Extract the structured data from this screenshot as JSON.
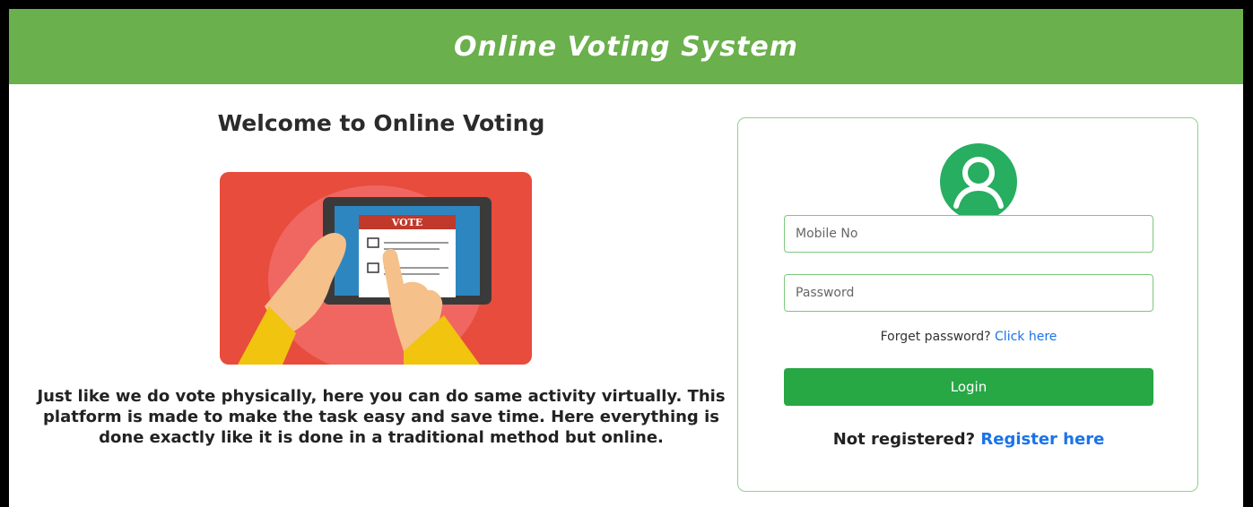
{
  "header": {
    "title": "Online Voting System"
  },
  "welcome": {
    "heading": "Welcome to Online Voting",
    "illustration_label": "VOTE",
    "description": "Just like we do vote physically, here you can do same activity virtually. This platform is made to make the task easy and save time. Here everything is done exactly like it is done in a traditional method but online."
  },
  "login": {
    "mobile_placeholder": "Mobile No",
    "password_placeholder": "Password",
    "forgot_text": "Forget password?",
    "forgot_link": "Click here",
    "login_button": "Login",
    "register_text": "Not registered?",
    "register_link": "Register here"
  },
  "colors": {
    "header_bg": "#6ab04c",
    "login_button": "#28a745",
    "link": "#1a73e8",
    "illustration_bg": "#e74c3c",
    "avatar": "#27ae60"
  },
  "icons": {
    "avatar": "user-avatar-icon"
  }
}
